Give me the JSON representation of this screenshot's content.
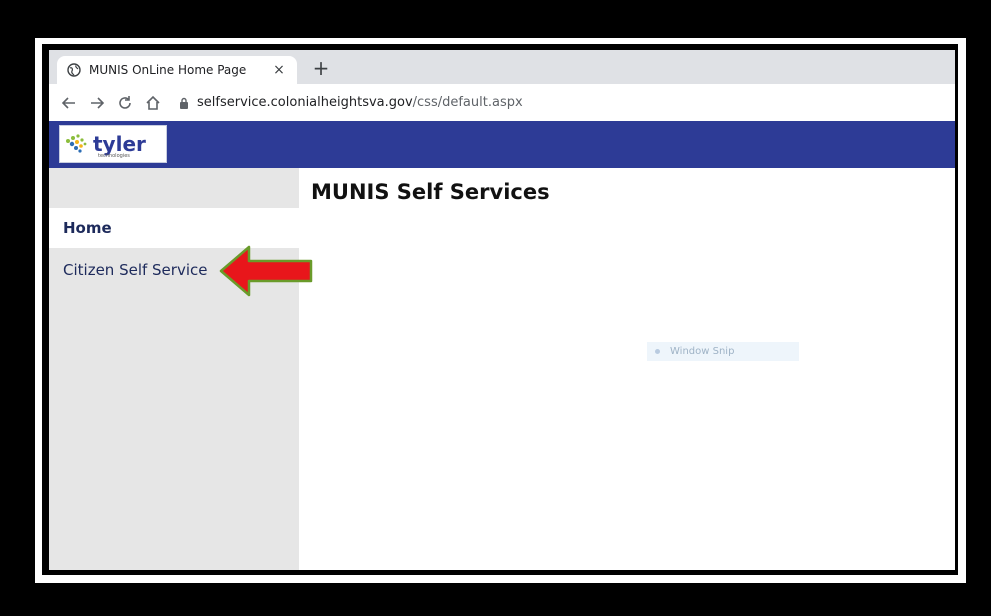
{
  "browser": {
    "tab_title": "MUNIS OnLine Home Page",
    "tab_close": "×",
    "new_tab": "+",
    "url_host": "selfservice.colonialheightsva.gov",
    "url_path": "/css/default.aspx"
  },
  "banner": {
    "logo_text": "tyler",
    "logo_subtext": "technologies",
    "color": "#2d3b96"
  },
  "sidebar": {
    "items": [
      {
        "label": "Home"
      },
      {
        "label": "Citizen Self Service"
      }
    ]
  },
  "main": {
    "title": "MUNIS Self Services"
  },
  "overlay": {
    "snip_label": "Window Snip"
  },
  "annotation": {
    "arrow_color": "#e8161b",
    "arrow_outline": "#6a9b2a"
  }
}
